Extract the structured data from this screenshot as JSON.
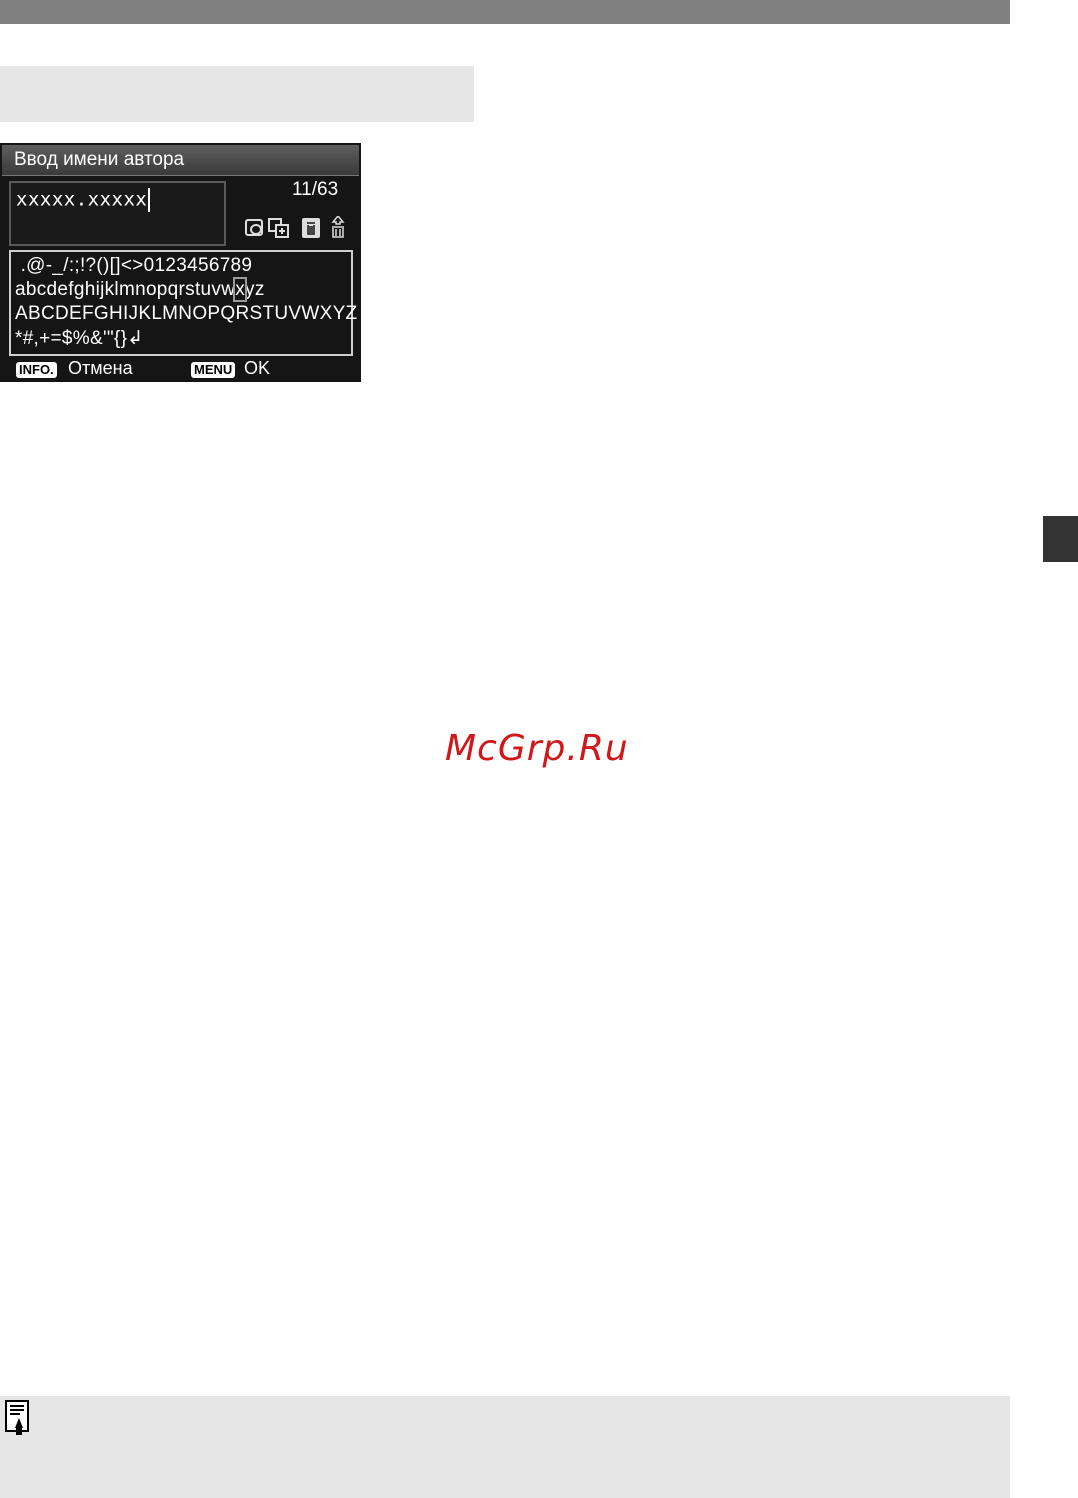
{
  "screen": {
    "title": "Ввод имени автора",
    "input_value": "xxxxx.xxxxx",
    "counter": "11/63",
    "char_rows": [
      " .@-_/:;!?()[]<>0123456789",
      "abcdefghijklmnopqrstuvw",
      "ABCDEFGHIJKLMNOPQRSTUVWXYZ",
      "*#,+=$%&'\"{}↲"
    ],
    "selected_char": "x",
    "row2_after": "yz",
    "info_button": "INFO.",
    "cancel_label": "Отмена",
    "menu_button": "MENU",
    "ok_label": "OK"
  },
  "watermark": "McGrp.Ru",
  "icons": [
    "magnify-icon",
    "insert-icon",
    "trash-icon",
    "trash-case-icon",
    "note-icon"
  ]
}
